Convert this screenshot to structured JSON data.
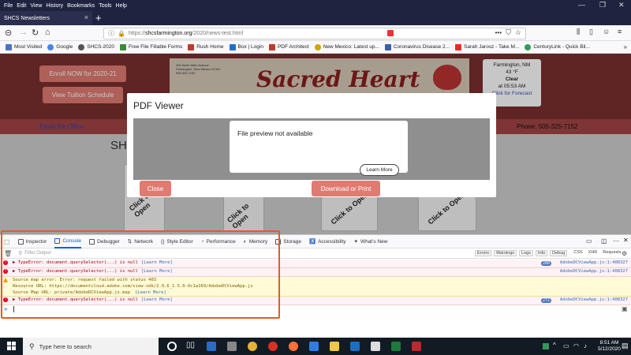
{
  "menubar": {
    "items": [
      "File",
      "Edit",
      "View",
      "History",
      "Bookmarks",
      "Tools",
      "Help"
    ]
  },
  "tab": {
    "title": "SHCS Newsletters"
  },
  "navbar": {
    "url_prefix": "https://",
    "url_domain": "shcsfarmington.org",
    "url_path": "/2020/news-test.html"
  },
  "bookmarks": [
    {
      "label": "Most Visited",
      "color": "#4d73c4"
    },
    {
      "label": "Google",
      "color": "#4285f4"
    },
    {
      "label": "SHCS-2020",
      "color": "#555555"
    },
    {
      "label": "Free File Fillable Forms",
      "color": "#3a8a3a"
    },
    {
      "label": "Rush Home",
      "color": "#c0392b"
    },
    {
      "label": "Box | Login",
      "color": "#1f6fd1"
    },
    {
      "label": "PDF Architect",
      "color": "#c0392b"
    },
    {
      "label": "New Mexico: Latest up...",
      "color": "#d4a300"
    },
    {
      "label": "Coronavirus Disease 2...",
      "color": "#3a5fb0"
    },
    {
      "label": "Sarah Jarosz - Take M...",
      "color": "#e52d27"
    },
    {
      "label": "CenturyLink - Quick Bil...",
      "color": "#2e9e4f"
    }
  ],
  "site": {
    "enroll_label": "Enroll NOW for 2020-21",
    "tuition_label": "View Tuition Schedule",
    "banner_title": "Sacred Heart",
    "banner_address": [
      "404 North Allen Avenue",
      "Farmington, New Mexico 87401",
      "505.325.7152"
    ],
    "weather_city": "Farmington, NM",
    "weather_temp": "43 °F",
    "weather_cond": "Clear",
    "weather_time": "at 05:53 AM",
    "weather_link": "Click for Forecast",
    "email_link": "Email the Office",
    "phone": "Phone: 505-325-7152",
    "heading_partial": "SHC",
    "click_to_open": "Click to Open"
  },
  "modal": {
    "title": "PDF Viewer",
    "preview_text": "File preview not available",
    "learn_more": "Learn More",
    "close": "Close",
    "download": "Download or Print"
  },
  "devtools": {
    "tabs": [
      "Inspector",
      "Console",
      "Debugger",
      "Network",
      "Style Editor",
      "Performance",
      "Memory",
      "Storage",
      "Accessibility",
      "What's New"
    ],
    "filter_placeholder": "Filter Output",
    "filters": [
      "Errors",
      "Warnings",
      "Logs",
      "Info",
      "Debug",
      "CSS",
      "XHR",
      "Requests"
    ],
    "messages": [
      {
        "type": "error",
        "text": "▶ TypeError: document.querySelector(...) is null",
        "link": "[Learn More]",
        "badge": "288",
        "source": "AdobeDCViewApp.js:1:408327"
      },
      {
        "type": "error",
        "text": "▶ TypeError: document.querySelector(...) is null",
        "link": "[Learn More]",
        "badge": "",
        "source": "AdobeDCViewApp.js:1:408327"
      },
      {
        "type": "warning",
        "text": "Source map error: Error: request failed with status 403",
        "line2": "Resource URL: https://documentcloud.adobe.com/view-sdk/2.9.6_1.5.0-0c1a169/AdobeDCViewApp.js",
        "line3": "Source Map URL: private/AdobeDCViewApp.js.map",
        "link": "[Learn More]"
      },
      {
        "type": "error",
        "text": "▶ TypeError: document.querySelector(...) is null",
        "link": "[Learn More]",
        "badge": "272",
        "source": "AdobeDCViewApp.js:1:408327"
      }
    ],
    "prompt": "»"
  },
  "taskbar": {
    "search_placeholder": "Type here to search",
    "time": "8:51 AM",
    "date": "5/12/2020"
  },
  "colors": {
    "header": "#7a2f2f",
    "button_red": "#e07b72",
    "highlight": "#e8582a",
    "taskbar": "#121a24"
  }
}
